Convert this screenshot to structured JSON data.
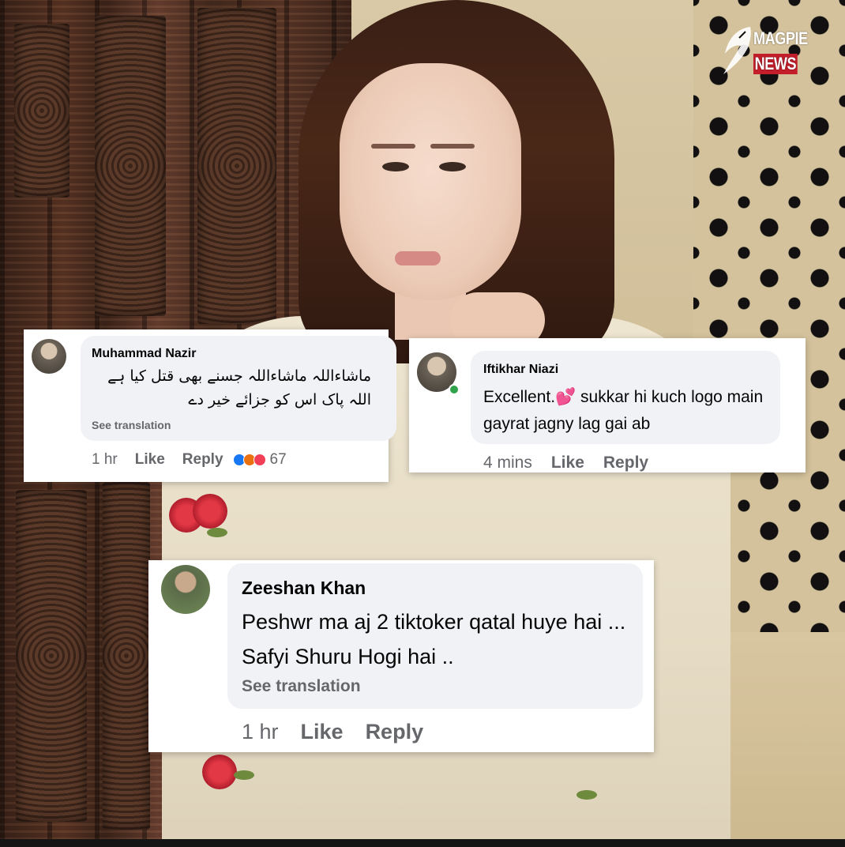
{
  "watermark": {
    "line1": "MAGPIE",
    "line2": "NEWS",
    "icon": "magpie-bird-icon"
  },
  "comments": [
    {
      "author": "Muhammad Nazir",
      "text_line1": "ماشاءاللہ ماشاءاللہ جسنے بھی قتل کیا ہے",
      "text_line2": "اللہ پاک اس کو جزائے خیر دے",
      "see_translation": "See translation",
      "time": "1 hr",
      "like_label": "Like",
      "reply_label": "Reply",
      "reactions": [
        "like",
        "angry",
        "love"
      ],
      "reaction_count": "67"
    },
    {
      "author": "Iftikhar Niazi",
      "text_part1": "Excellent.",
      "emoji": "💕",
      "text_part2": " sukkar hi kuch logo main gayrat jagny lag gai ab",
      "time": "4 mins",
      "like_label": "Like",
      "reply_label": "Reply",
      "online": true
    },
    {
      "author": "Zeeshan Khan",
      "text": "Peshwr ma aj 2 tiktoker qatal huye hai ... Safyi Shuru Hogi hai ..",
      "see_translation": "See translation",
      "time": "1 hr",
      "like_label": "Like",
      "reply_label": "Reply"
    }
  ],
  "colors": {
    "bubble": "#f0f2f5",
    "meta_text": "#65676b",
    "name_text": "#050505",
    "online": "#31a24c",
    "react_like": "#1877f2",
    "react_angry": "#e9710f",
    "react_love": "#f33e58"
  }
}
